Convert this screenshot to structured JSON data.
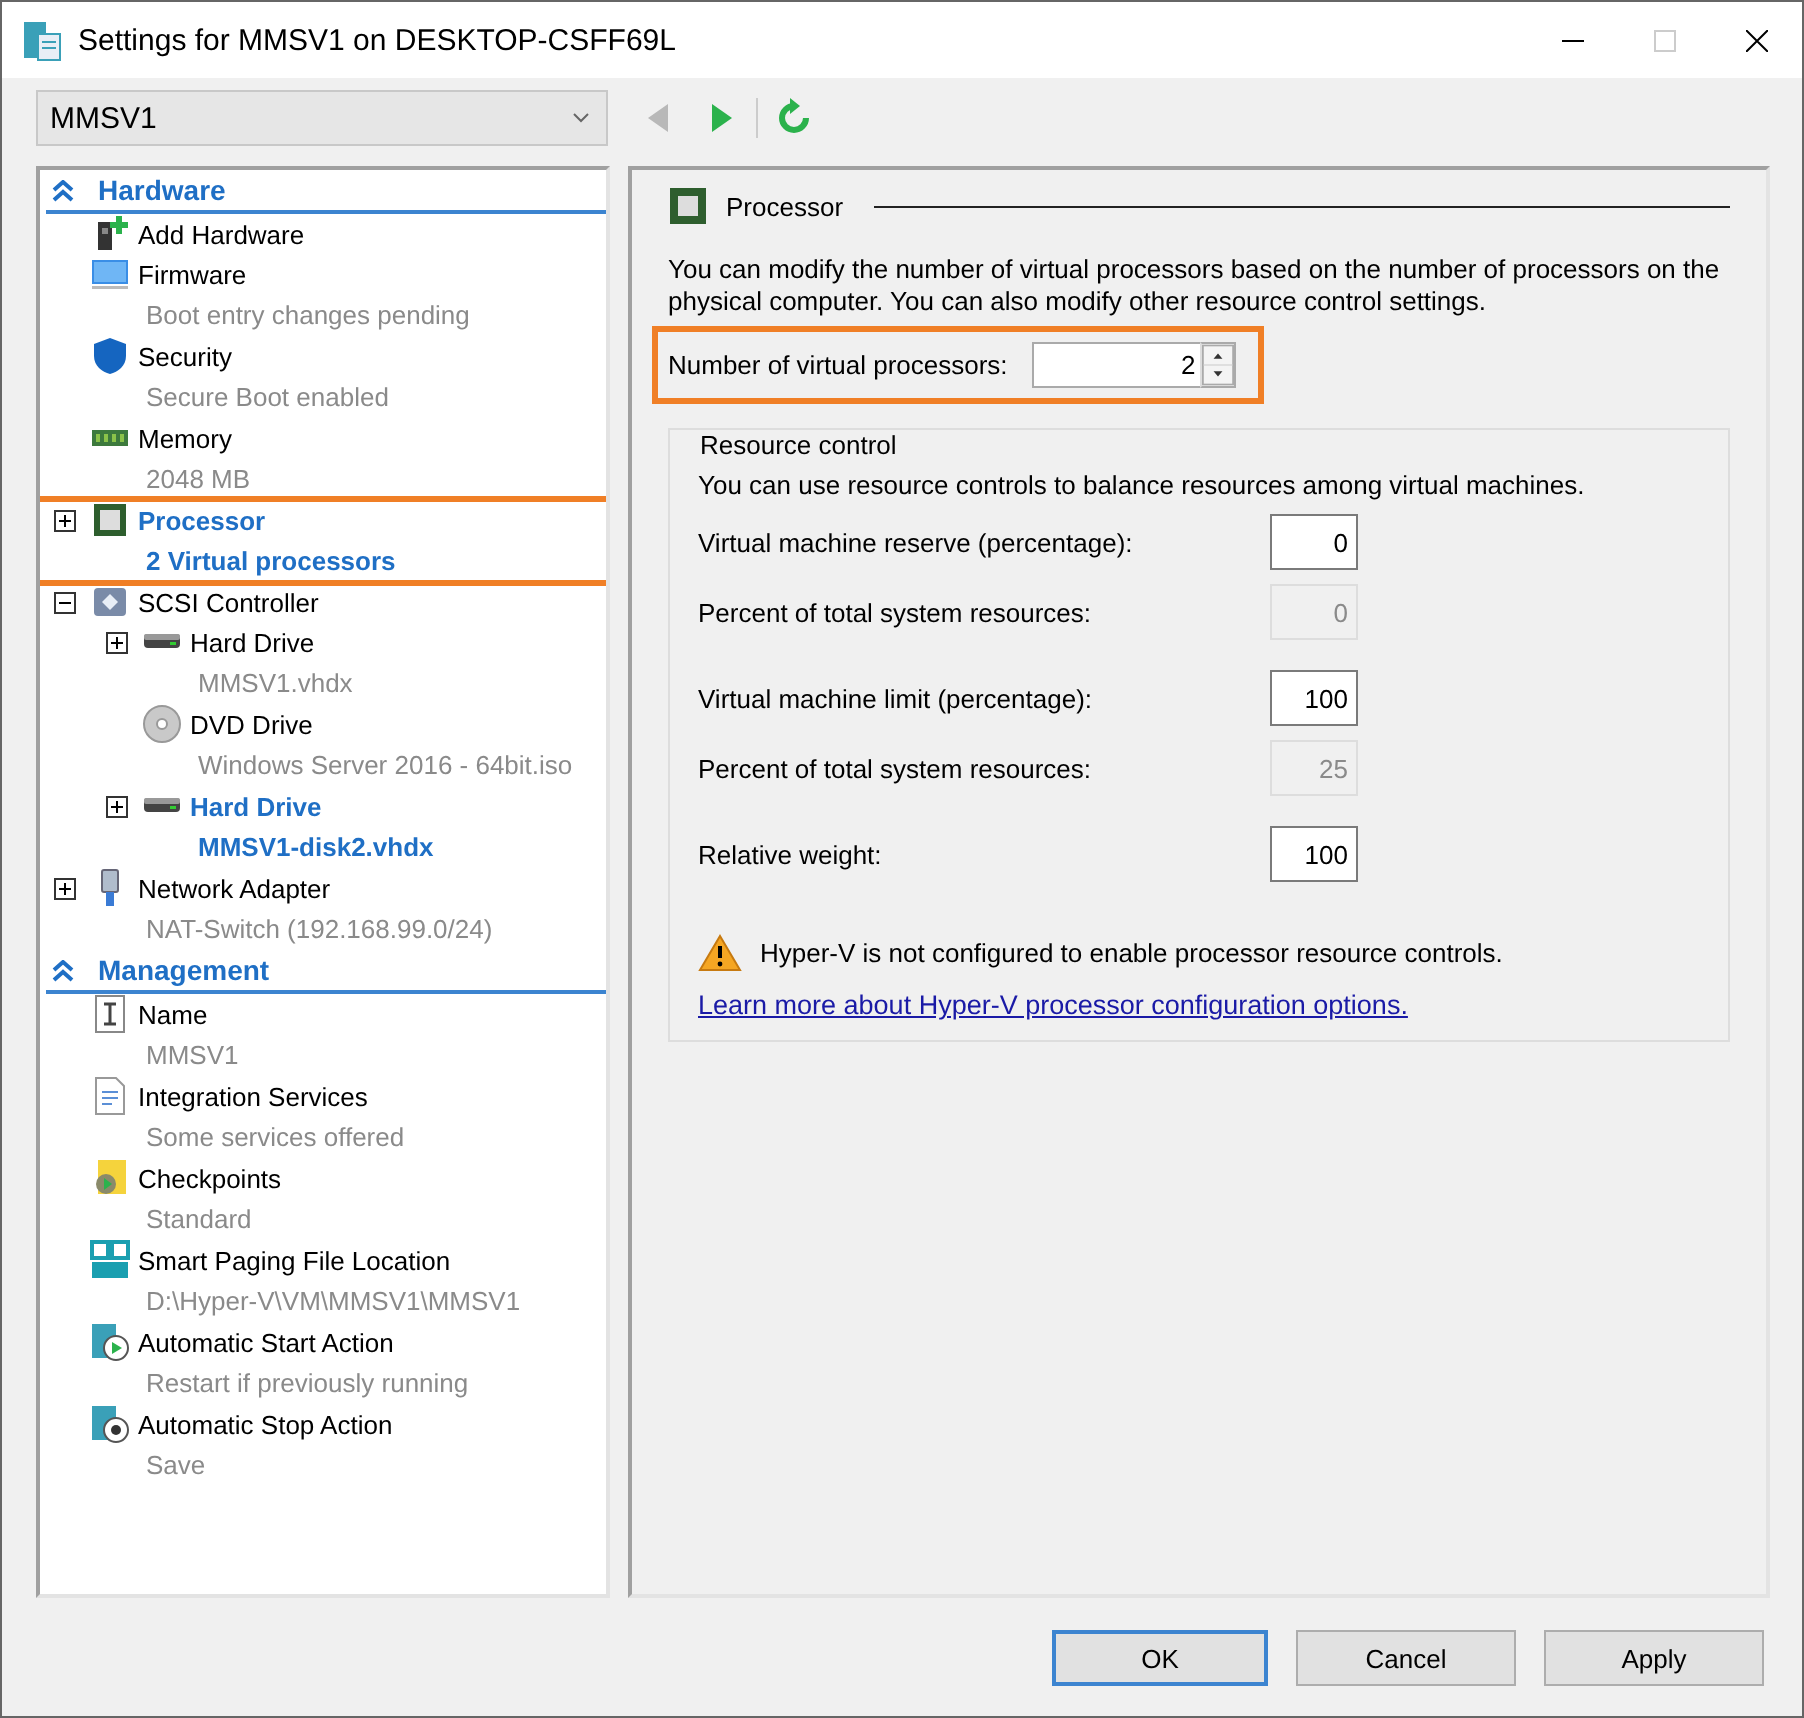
{
  "window": {
    "title": "Settings for MMSV1 on DESKTOP-CSFF69L"
  },
  "vm_selector": {
    "value": "MMSV1"
  },
  "toolbar": [
    {
      "kind": "back",
      "disabled": true
    },
    {
      "kind": "forward",
      "disabled": false
    },
    {
      "kind": "refresh",
      "disabled": false
    }
  ],
  "sidebar": {
    "sections": [
      {
        "title": "Hardware",
        "items": [
          {
            "kind": "add-hardware",
            "label": "Add Hardware",
            "highlighted": false
          },
          {
            "kind": "firmware",
            "label": "Firmware",
            "detail": "Boot entry changes pending",
            "highlighted": false
          },
          {
            "kind": "security",
            "label": "Security",
            "detail": "Secure Boot enabled",
            "highlighted": false
          },
          {
            "kind": "memory",
            "label": "Memory",
            "detail": "2048 MB",
            "highlighted": false
          },
          {
            "kind": "processor",
            "label": "Processor",
            "detail": "2 Virtual processors",
            "highlighted": true,
            "expanded": false,
            "annotated": true
          },
          {
            "kind": "controller",
            "label": "SCSI Controller",
            "highlighted": false,
            "expanded": true,
            "children": [
              {
                "kind": "disk",
                "label": "Hard Drive",
                "detail": "MMSV1.vhdx",
                "highlighted": false,
                "expanded": false
              },
              {
                "kind": "dvd",
                "label": "DVD Drive",
                "detail": "Windows Server 2016 - 64bit.iso",
                "highlighted": false
              },
              {
                "kind": "disk",
                "label": "Hard Drive",
                "detail": "MMSV1-disk2.vhdx",
                "highlighted": true,
                "expanded": false
              }
            ]
          },
          {
            "kind": "network",
            "label": "Network Adapter",
            "detail": "NAT-Switch (192.168.99.0/24)",
            "highlighted": false,
            "expanded": false
          }
        ]
      },
      {
        "title": "Management",
        "items": [
          {
            "kind": "name",
            "label": "Name",
            "detail": "MMSV1",
            "highlighted": false
          },
          {
            "kind": "integration",
            "label": "Integration Services",
            "detail": "Some services offered",
            "highlighted": false
          },
          {
            "kind": "checkpoint",
            "label": "Checkpoints",
            "detail": "Standard",
            "highlighted": false
          },
          {
            "kind": "paging",
            "label": "Smart Paging File Location",
            "detail": "D:\\Hyper-V\\VM\\MMSV1\\MMSV1",
            "highlighted": false
          },
          {
            "kind": "start",
            "label": "Automatic Start Action",
            "detail": "Restart if previously running",
            "highlighted": false
          },
          {
            "kind": "stop",
            "label": "Automatic Stop Action",
            "detail": "Save",
            "highlighted": false
          }
        ]
      }
    ]
  },
  "processor_panel": {
    "title": "Processor",
    "description": "You can modify the number of virtual processors based on the number of processors on the physical computer. You can also modify other resource control settings.",
    "count_field": {
      "label": "Number of virtual processors:",
      "value": "2",
      "annotated": true
    },
    "resource_control": {
      "title": "Resource control",
      "description": "You can use resource controls to balance resources among virtual machines.",
      "fields": [
        {
          "label": "Virtual machine reserve (percentage):",
          "value": "0",
          "disabled": false
        },
        {
          "label": "Percent of total system resources:",
          "value": "0",
          "disabled": true
        },
        {
          "label": "Virtual machine limit (percentage):",
          "value": "100",
          "disabled": false
        },
        {
          "label": "Percent of total system resources:",
          "value": "25",
          "disabled": true
        },
        {
          "label": "Relative weight:",
          "value": "100",
          "disabled": false
        }
      ],
      "warning": "Hyper-V is not configured to enable processor resource controls.",
      "link": "Learn more about Hyper-V processor configuration options."
    }
  },
  "buttons": [
    {
      "label": "OK",
      "default": true
    },
    {
      "label": "Cancel",
      "default": false
    },
    {
      "label": "Apply",
      "default": false
    }
  ]
}
